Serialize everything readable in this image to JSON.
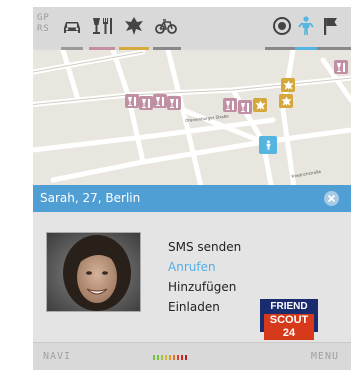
{
  "toolbar": {
    "gps_line1": "GP",
    "gps_line2": "RS",
    "icons": [
      "car-icon",
      "restaurant-icon",
      "event-icon",
      "bicycle-icon",
      "target-icon",
      "person-icon",
      "flag-icon"
    ]
  },
  "map": {
    "street_names": [
      "Oranienburger Straße",
      "Friedrichstraße"
    ]
  },
  "contact": {
    "name": "Sarah, 27, Berlin"
  },
  "actions": {
    "items": [
      "SMS senden",
      "Anrufen",
      "Hinzufügen",
      "Einladen"
    ],
    "active_index": 1
  },
  "logo": {
    "line1": "FRIEND",
    "line2": "SCOUT 24"
  },
  "bottom_bar": {
    "left": "NAVI",
    "right": "MENU"
  },
  "colors": {
    "accent_blue": "#4f9fd4",
    "active_link": "#55aee8",
    "pin_pink": "#c08fa3",
    "pin_gold": "#d4a83a"
  }
}
